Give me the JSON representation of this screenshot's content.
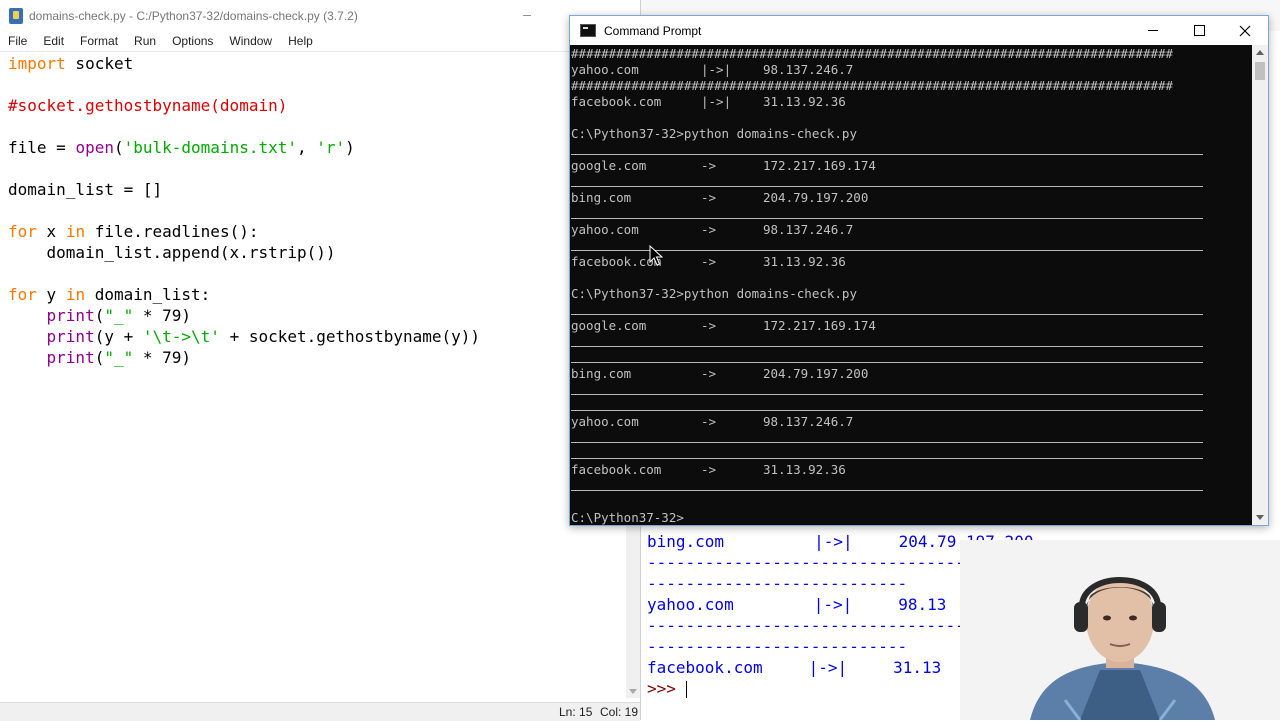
{
  "editor": {
    "title": "domains-check.py - C:/Python37-32/domains-check.py (3.7.2)",
    "minimize_glyph": "–",
    "menu": [
      "File",
      "Edit",
      "Format",
      "Run",
      "Options",
      "Window",
      "Help"
    ],
    "code": {
      "l1_kw": "import",
      "l1_rest": " socket",
      "l3_comment": "#socket.gethostbyname(domain)",
      "l5_pre": "file = ",
      "l5_bi": "open",
      "l5_open": "(",
      "l5_str1": "'bulk-domains.txt'",
      "l5_mid": ", ",
      "l5_str2": "'r'",
      "l5_close": ")",
      "l7": "domain_list = []",
      "l9_kw1": "for",
      "l9_mid": " x ",
      "l9_kw2": "in",
      "l9_rest": " file.readlines():",
      "l10": "    domain_list.append(x.rstrip())",
      "l12_kw1": "for",
      "l12_mid": " y ",
      "l12_kw2": "in",
      "l12_rest": " domain_list:",
      "l13_ind": "    ",
      "l13_bi": "print",
      "l13_open": "(",
      "l13_str": "\"_\"",
      "l13_rest": " * 79)",
      "l14_ind": "    ",
      "l14_bi": "print",
      "l14_pre": "(y + ",
      "l14_str": "'\\t->\\t'",
      "l14_rest": " + socket.gethostbyname(y))",
      "l15_ind": "    ",
      "l15_bi": "print",
      "l15_open": "(",
      "l15_str": "\"_\"",
      "l15_rest": " * 79)"
    },
    "status": {
      "line": "Ln: 15",
      "col": "Col: 19"
    }
  },
  "shell": {
    "lines": [
      {
        "domain": "bing.com",
        "arrow": "|->|",
        "ip": "204.79.197.200"
      },
      {
        "dash1": "----------------------------------------",
        "dash2": "---------------------------"
      },
      {
        "domain": "yahoo.com",
        "arrow": "|->|",
        "ip": "98.13"
      },
      {
        "dash1": "----------------------------------------",
        "dash2": "---------------------------"
      },
      {
        "domain": "facebook.com",
        "arrow": "|->|",
        "ip": "31.13"
      }
    ],
    "prompt": ">>>"
  },
  "cmd": {
    "title": "Command Prompt",
    "hashes": "################################################################################",
    "block1": [
      {
        "domain": "yahoo.com",
        "sep": "|->|",
        "ip": "98.137.246.7"
      },
      {
        "domain": "facebook.com",
        "sep": "|->|",
        "ip": "31.13.92.36"
      }
    ],
    "prompt_cmd": "C:\\Python37-32>python domains-check.py",
    "block2": [
      {
        "domain": "google.com",
        "sep": "->",
        "ip": "172.217.169.174"
      },
      {
        "domain": "bing.com",
        "sep": "->",
        "ip": "204.79.197.200"
      },
      {
        "domain": "yahoo.com",
        "sep": "->",
        "ip": "98.137.246.7"
      },
      {
        "domain": "facebook.com",
        "sep": "->",
        "ip": "31.13.92.36"
      }
    ],
    "block3": [
      {
        "domain": "google.com",
        "sep": "->",
        "ip": "172.217.169.174"
      },
      {
        "domain": "bing.com",
        "sep": "->",
        "ip": "204.79.197.200"
      },
      {
        "domain": "yahoo.com",
        "sep": "->",
        "ip": "98.137.246.7"
      },
      {
        "domain": "facebook.com",
        "sep": "->",
        "ip": "31.13.92.36"
      }
    ],
    "final_prompt": "C:\\Python37-32>"
  },
  "colors": {
    "keyword": "#ff7700",
    "string": "#00aa00",
    "comment": "#dd0000",
    "builtin": "#900090",
    "cmd_bg": "#0c0c0c",
    "cmd_text": "#c0c0c0",
    "shell_link": "#0000ee"
  },
  "icons": [
    "python-file-icon",
    "cmd-icon",
    "minimize-icon",
    "maximize-icon",
    "close-icon",
    "mouse-pointer-icon"
  ]
}
